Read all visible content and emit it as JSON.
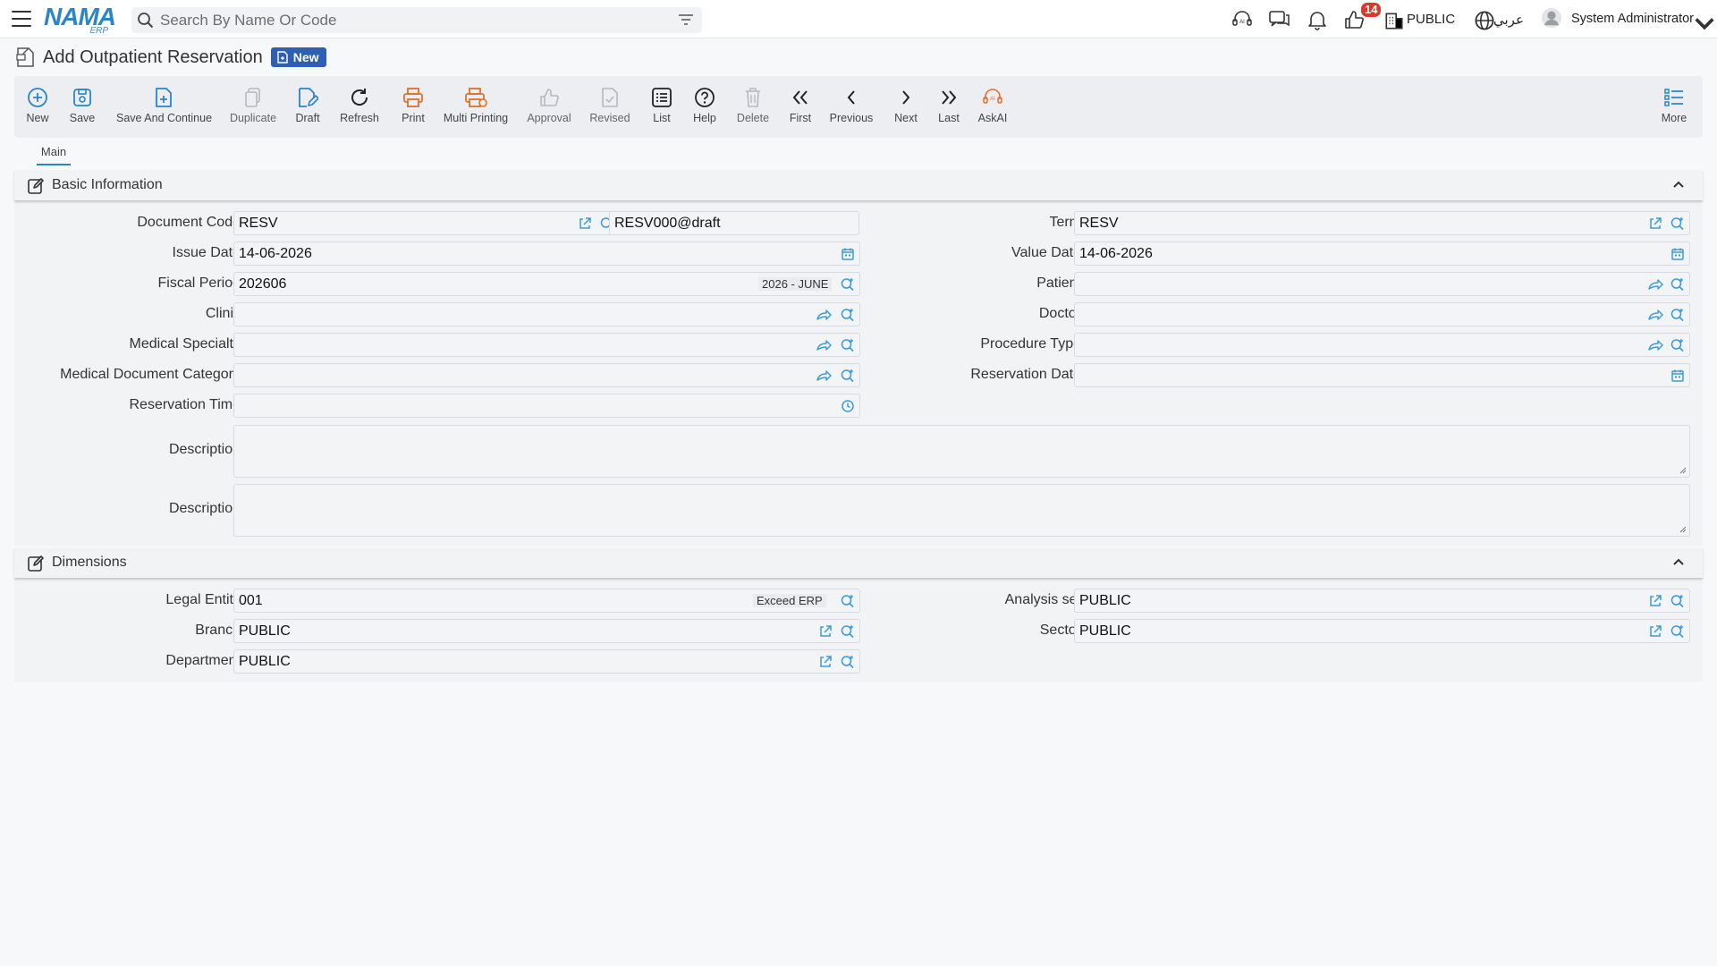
{
  "topbar": {
    "logo_main": "NAMA",
    "logo_sub": "ERP",
    "search_placeholder": "Search By Name Or Code",
    "notification_count": "14",
    "analysis_set": "PUBLIC",
    "language": "عربي",
    "user_name": "System Administrator"
  },
  "page": {
    "title": "Add Outpatient Reservation",
    "status_badge": "New"
  },
  "toolbar": {
    "new": "New",
    "save": "Save",
    "save_continue": "Save And Continue",
    "duplicate": "Duplicate",
    "draft": "Draft",
    "refresh": "Refresh",
    "print": "Print",
    "multi_printing": "Multi Printing",
    "approval": "Approval",
    "revised": "Revised",
    "list": "List",
    "help": "Help",
    "delete": "Delete",
    "first": "First",
    "previous": "Previous",
    "next": "Next",
    "last": "Last",
    "askai": "AskAI",
    "more": "More"
  },
  "tabs": {
    "main": "Main"
  },
  "basic": {
    "title": "Basic Information",
    "document_code_label": "Document Code",
    "document_code_value": "RESV",
    "document_number_value": "RESV000@draft",
    "term_label": "Term",
    "term_value": "RESV",
    "issue_date_label": "Issue Date",
    "issue_date_value": "14-06-2026",
    "value_date_label": "Value Date",
    "value_date_value": "14-06-2026",
    "fiscal_period_label": "Fiscal Period",
    "fiscal_period_value": "202606",
    "fiscal_period_hint": "2026 - JUNE",
    "patient_label": "Patient",
    "clinic_label": "Clinic",
    "doctor_label": "Doctor",
    "medical_specialty_label": "Medical Specialty",
    "procedure_type_label": "Procedure Type",
    "medical_doc_category_label": "Medical Document Category",
    "reservation_date_label": "Reservation Date",
    "reservation_time_label": "Reservation Time",
    "description1_label": "Description",
    "description2_label": "Description"
  },
  "dimensions": {
    "title": "Dimensions",
    "legal_entity_label": "Legal Entity",
    "legal_entity_value": "001",
    "legal_entity_hint": "Exceed ERP",
    "analysis_set_label": "Analysis set",
    "analysis_set_value": "PUBLIC",
    "branch_label": "Branch",
    "branch_value": "PUBLIC",
    "sector_label": "Sector",
    "sector_value": "PUBLIC",
    "department_label": "Department",
    "department_value": "PUBLIC"
  }
}
